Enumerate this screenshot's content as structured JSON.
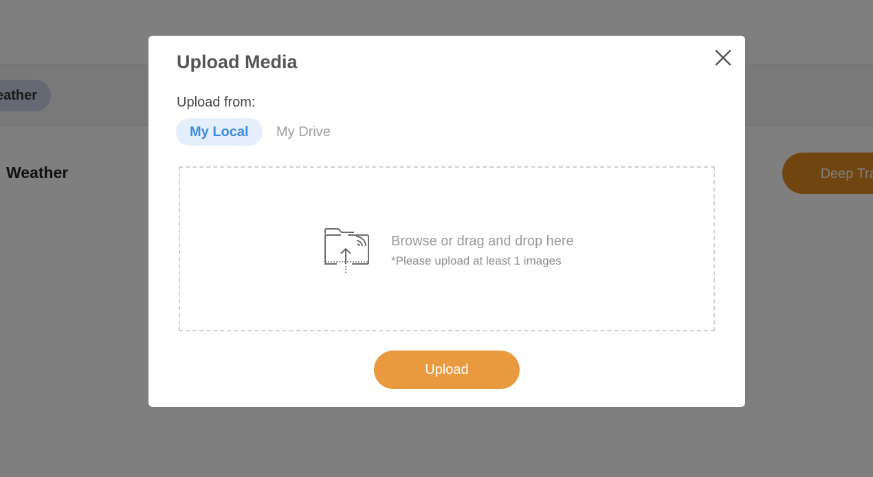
{
  "background": {
    "chip_label": "eather",
    "section_title": "Weather",
    "train_button_label": "Deep Train"
  },
  "modal": {
    "title": "Upload Media",
    "close_icon": "close-icon",
    "upload_from_label": "Upload from:",
    "tabs": [
      {
        "label": "My Local",
        "active": true
      },
      {
        "label": "My Drive",
        "active": false
      }
    ],
    "dropzone": {
      "icon": "folder-upload-icon",
      "primary_text": "Browse or drag and drop here",
      "note_text": "*Please upload at least 1 images"
    },
    "upload_button_label": "Upload"
  },
  "colors": {
    "accent_orange": "#e99a3e",
    "active_tab_text": "#3d8be0",
    "active_tab_bg": "#e5effc"
  }
}
